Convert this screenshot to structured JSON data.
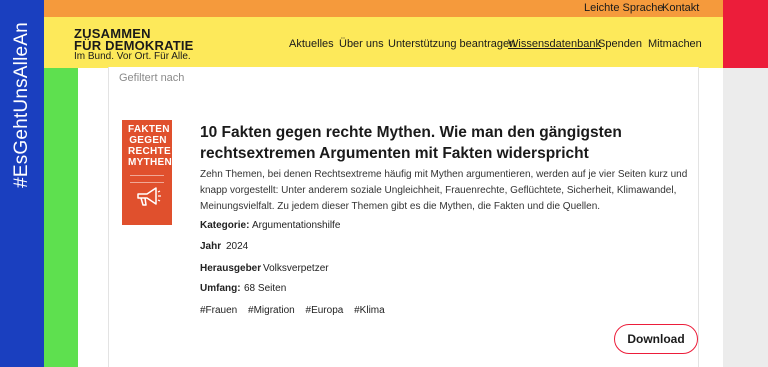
{
  "side_banner": {
    "hashtag": "#EsGehtUnsAlleAn"
  },
  "topbar": {
    "easy_language": "Leichte Sprache",
    "contact": "Kontakt"
  },
  "logo": {
    "line1": "ZUSAMMEN",
    "line2": "FÜR DEMOKRATIE",
    "tagline": "Im Bund. Vor Ort. Für Alle."
  },
  "nav": {
    "items": [
      {
        "label": "Aktuelles"
      },
      {
        "label": "Über uns"
      },
      {
        "label": "Unterstützung beantragen"
      },
      {
        "label": "Wissensdatenbank",
        "active": true
      },
      {
        "label": "Spenden"
      },
      {
        "label": "Mitmachen"
      }
    ]
  },
  "filter": {
    "label": "Gefiltert nach"
  },
  "item": {
    "cover_text": "FAKTEN GEGEN RECHTE MYTHEN",
    "title": "10 Fakten gegen rechte Mythen. Wie man den gängigsten rechtsextremen Argumenten mit Fakten widerspricht",
    "description": "Zehn Themen, bei denen Rechtsextreme häufig mit Mythen argumentieren, werden auf je vier Seiten kurz und knapp vorgestellt: Unter anderem soziale Ungleichheit, Frauenrechte, Geflüchtete, Sicherheit, Klimawandel, Meinungsvielfalt. Zu jedem dieser Themen gibt es die Mythen, die Fakten und die Quellen.",
    "meta": [
      {
        "label": "Kategorie:",
        "value": "Argumentationshilfe"
      },
      {
        "label": "Jahr",
        "value": "2024"
      },
      {
        "label": "Herausgeber",
        "value": "Volksverpetzer"
      },
      {
        "label": "Umfang:",
        "value": "68 Seiten"
      }
    ],
    "tags": [
      "#Frauen",
      "#Migration",
      "#Europa",
      "#Klima"
    ],
    "download_label": "Download"
  },
  "colors": {
    "blue": "#1a3fbf",
    "green": "#5ee04f",
    "orange": "#f59a3c",
    "yellow": "#fde95a",
    "red": "#ec1d3a",
    "cover": "#e0502d"
  }
}
